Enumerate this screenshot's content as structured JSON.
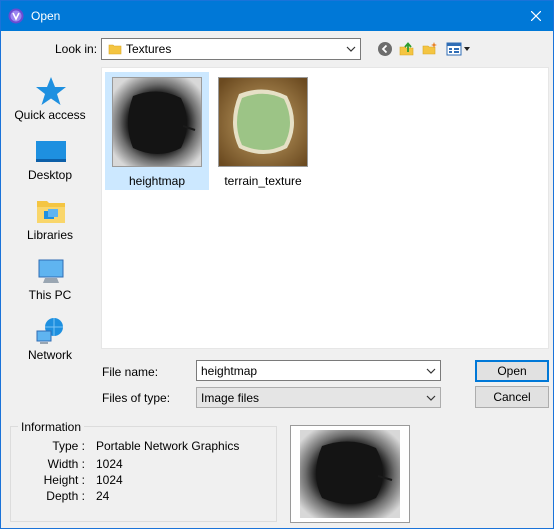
{
  "window": {
    "title": "Open"
  },
  "lookin": {
    "label": "Look in:",
    "value": "Textures"
  },
  "places": [
    {
      "label": "Quick access",
      "icon": "quick-access-star-icon"
    },
    {
      "label": "Desktop",
      "icon": "desktop-icon"
    },
    {
      "label": "Libraries",
      "icon": "libraries-icon"
    },
    {
      "label": "This PC",
      "icon": "this-pc-icon"
    },
    {
      "label": "Network",
      "icon": "network-icon"
    }
  ],
  "files": [
    {
      "name": "heightmap",
      "selected": true
    },
    {
      "name": "terrain_texture",
      "selected": false
    }
  ],
  "filename": {
    "label": "File name:",
    "value": "heightmap"
  },
  "filetype": {
    "label": "Files of type:",
    "value": "Image files"
  },
  "buttons": {
    "open": "Open",
    "cancel": "Cancel"
  },
  "info": {
    "legend": "Information",
    "type_label": "Type :",
    "type_value": "Portable Network Graphics",
    "width_label": "Width :",
    "width_value": "1024",
    "height_label": "Height :",
    "height_value": "1024",
    "depth_label": "Depth :",
    "depth_value": "24"
  },
  "colors": {
    "titlebar": "#0078d7",
    "selection": "#cce8ff",
    "accent": "#0078d7"
  }
}
